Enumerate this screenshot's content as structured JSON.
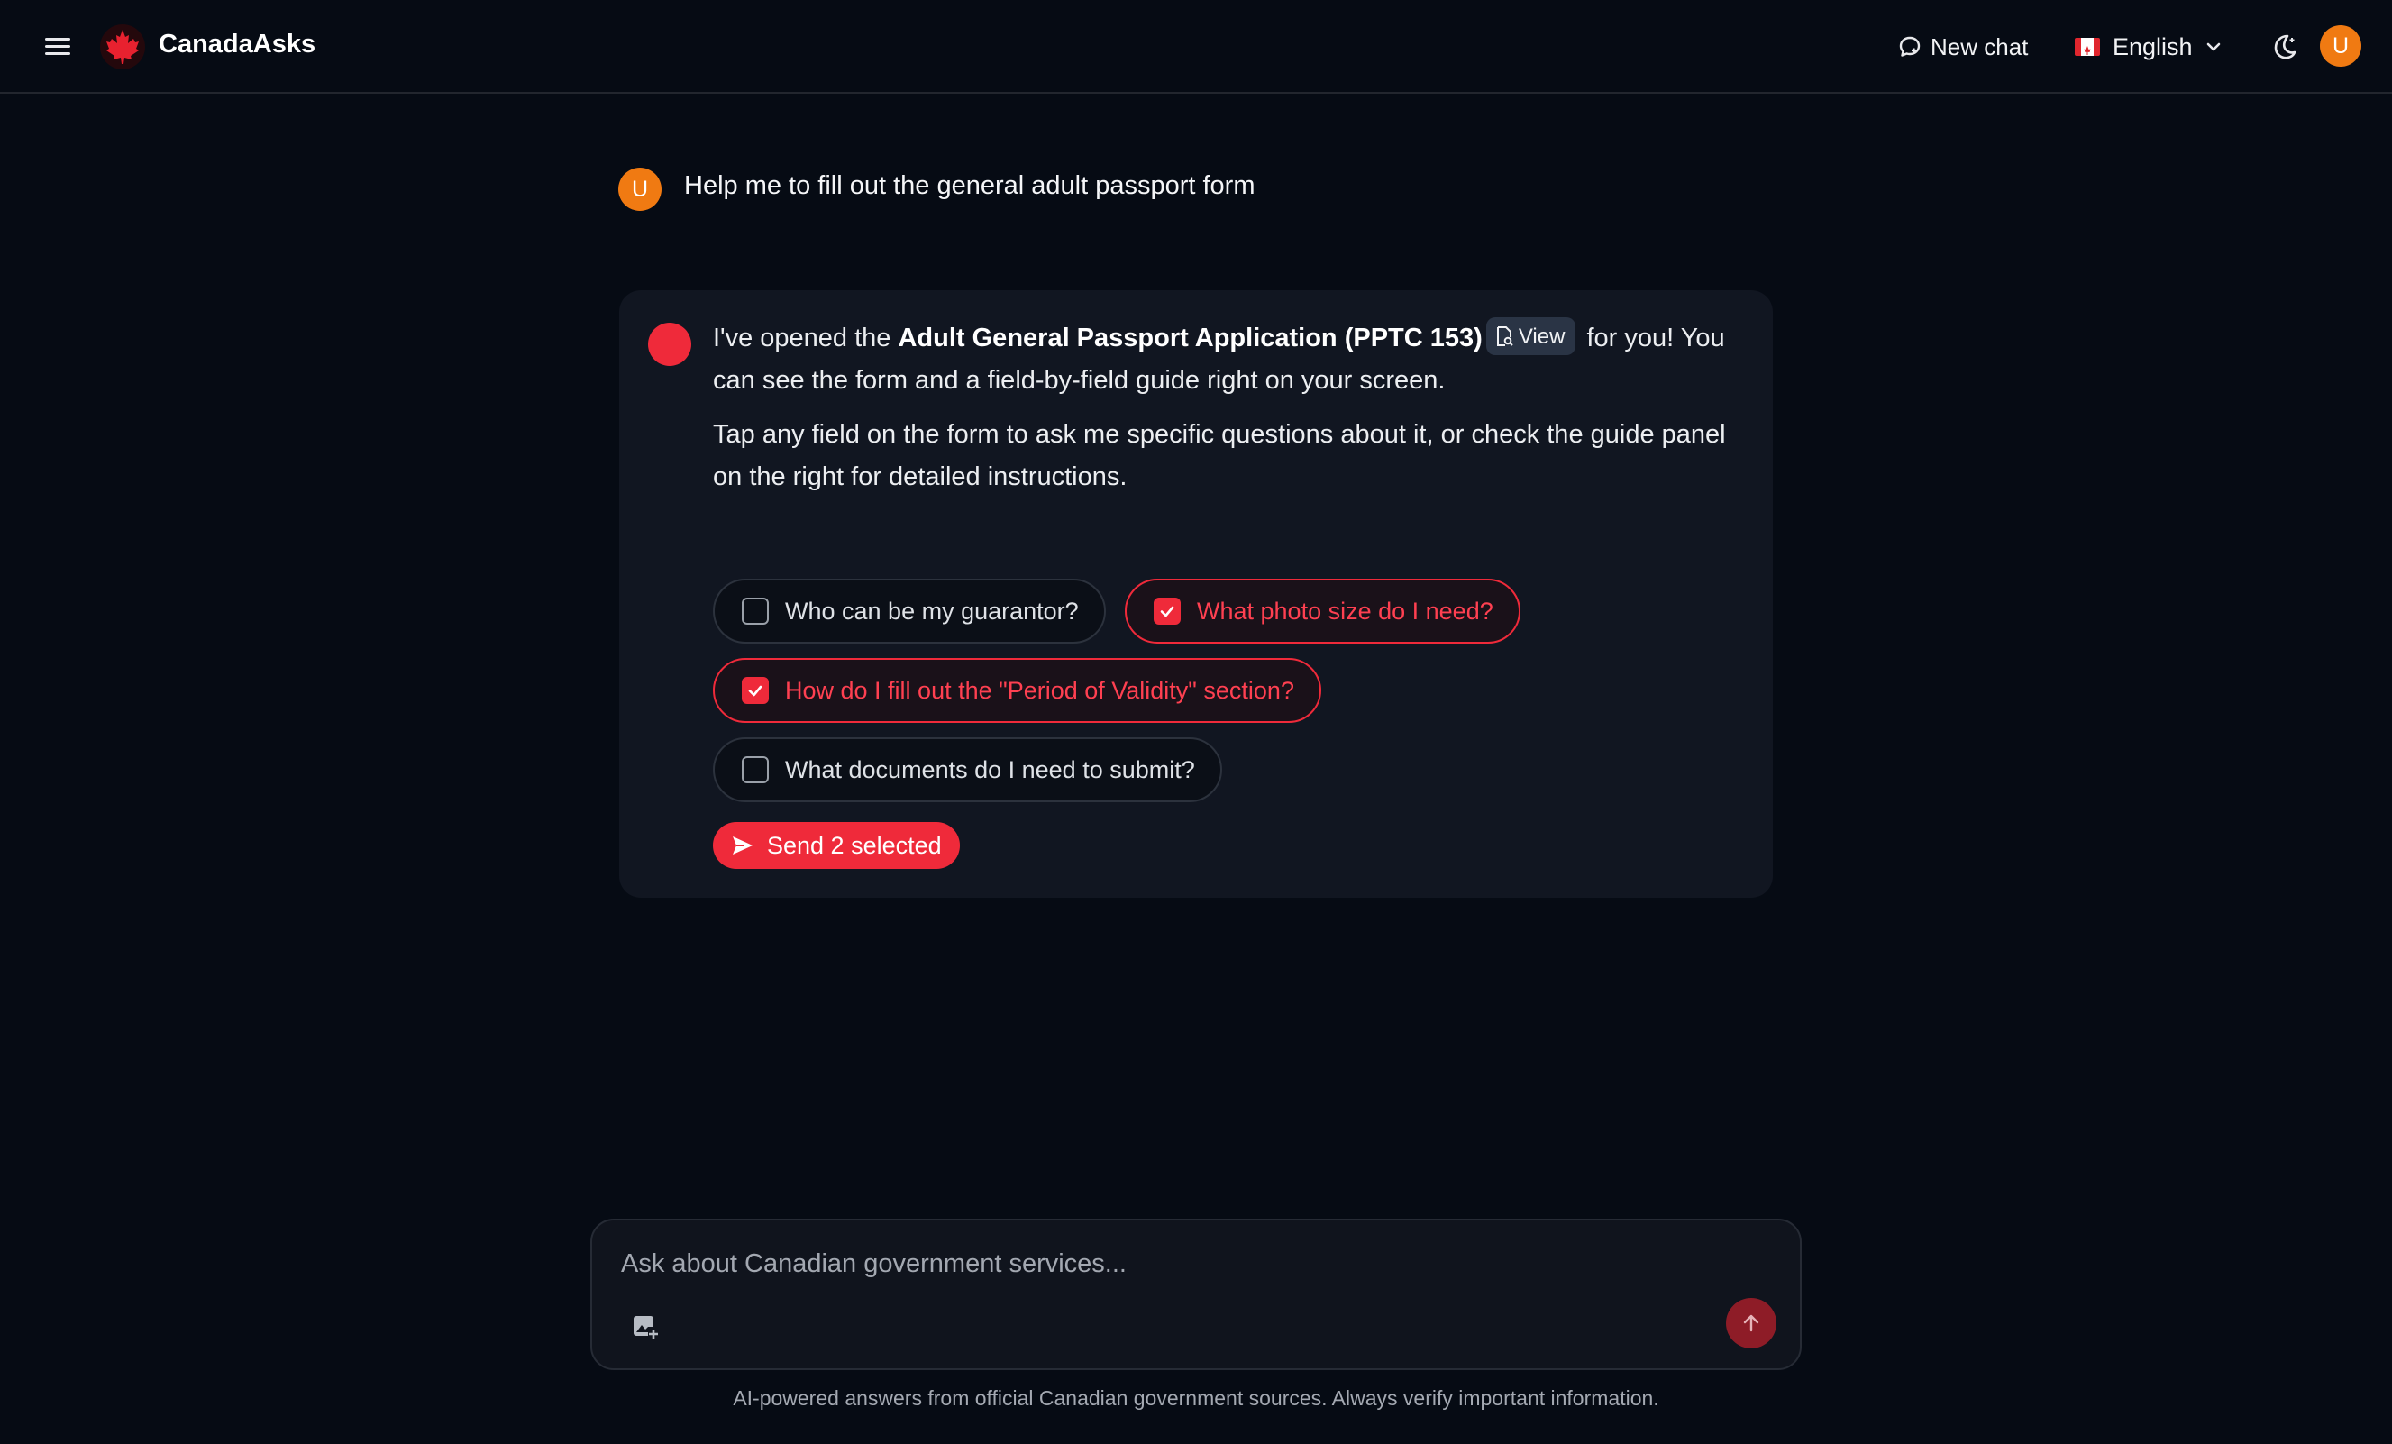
{
  "header": {
    "brand": "CanadaAsks",
    "new_chat_label": "New chat",
    "language_label": "English",
    "avatar_initial": "U"
  },
  "conversation": {
    "user_avatar_initial": "U",
    "user_message": "Help me to fill out the general adult passport form",
    "bot": {
      "intro_before": "I've opened the ",
      "form_name": "Adult General Passport Application (PPTC 153)",
      "view_label": "View",
      "intro_after": " for you! You can see the form and a field-by-field guide right on your screen.",
      "paragraph2": "Tap any field on the form to ask me specific questions about it, or check the guide panel on the right for detailed instructions.",
      "suggestions": [
        {
          "label": "Who can be my guarantor?",
          "selected": false
        },
        {
          "label": "What photo size do I need?",
          "selected": true
        },
        {
          "label": "How do I fill out the \"Period of Validity\" section?",
          "selected": true
        },
        {
          "label": "What documents do I need to submit?",
          "selected": false
        }
      ],
      "send_selected_label": "Send 2 selected"
    }
  },
  "composer": {
    "placeholder": "Ask about Canadian government services...",
    "value": ""
  },
  "footer_note": "AI-powered answers from official Canadian government sources. Always verify important information.",
  "colors": {
    "background": "#060b14",
    "accent_red": "#ef2a3a",
    "avatar_orange": "#f07a12",
    "card": "#111621"
  },
  "icons": [
    "menu-icon",
    "maple-leaf-icon",
    "chat-icon",
    "canada-flag-icon",
    "chevron-down-icon",
    "moon-icon",
    "document-search-icon",
    "checkbox-icon",
    "send-icon",
    "add-image-icon",
    "arrow-up-icon"
  ]
}
